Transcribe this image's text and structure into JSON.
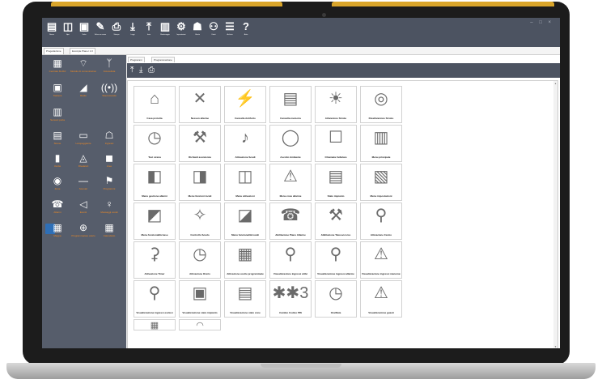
{
  "toolbar": {
    "buttons": [
      {
        "label": "Nuovo",
        "icon": "new-file-icon",
        "glyph": "▤"
      },
      {
        "label": "Apri",
        "icon": "open-icon",
        "glyph": "◫"
      },
      {
        "label": "Salva",
        "icon": "save-icon",
        "glyph": "▣"
      },
      {
        "label": "Salva con nome",
        "icon": "save-as-icon",
        "glyph": "✎"
      },
      {
        "label": "Stampa",
        "icon": "print-icon",
        "glyph": "⎙"
      },
      {
        "label": "Leggi",
        "icon": "download-icon",
        "glyph": "⤓"
      },
      {
        "label": "Invia",
        "icon": "upload-icon",
        "glyph": "⤒"
      },
      {
        "label": "Monitoraggio",
        "icon": "chart-icon",
        "glyph": "▥"
      },
      {
        "label": "Impostazioni",
        "icon": "gear-icon",
        "glyph": "⚙"
      },
      {
        "label": "Utente",
        "icon": "user-icon",
        "glyph": "☗"
      },
      {
        "label": "Utenti",
        "icon": "users-icon",
        "glyph": "⚇"
      },
      {
        "label": "Archivio",
        "icon": "database-icon",
        "glyph": "☰"
      },
      {
        "label": "Aiuto",
        "icon": "help-icon",
        "glyph": "?"
      }
    ],
    "window_controls": "–  □  ×"
  },
  "tabs": [
    "Progettazione",
    "Ecostyle Planer 1.0"
  ],
  "sidebar": {
    "items": [
      {
        "label": "Centrale M-210",
        "glyph": "▦"
      },
      {
        "label": "Modulo di comunicazione",
        "glyph": "⌔"
      },
      {
        "label": "Fotocellula",
        "glyph": "ᛉ"
      },
      {
        "label": "Tastiera",
        "glyph": "▣"
      },
      {
        "label": "Radio",
        "glyph": "◢"
      },
      {
        "label": "Telecomando",
        "glyph": "((•))"
      },
      {
        "label": "Sensori porta",
        "glyph": "▥"
      },
      {
        "label": "Sirene",
        "glyph": "▤"
      },
      {
        "label": "Lampeggiante",
        "glyph": "▭"
      },
      {
        "label": "Ingressi",
        "glyph": "☖"
      },
      {
        "label": "Uscite",
        "glyph": "▮"
      },
      {
        "label": "Rivelatori",
        "glyph": "◬"
      },
      {
        "label": "Aree",
        "glyph": "◼"
      },
      {
        "label": "Zone",
        "glyph": "◉"
      },
      {
        "label": "Scenari",
        "glyph": "—"
      },
      {
        "label": "Programmi",
        "glyph": "⚑"
      },
      {
        "label": "Allarmi",
        "glyph": "☎"
      },
      {
        "label": "Eventi",
        "glyph": "◁"
      },
      {
        "label": "Messaggi vocali",
        "glyph": "♀"
      },
      {
        "label": "Mappa",
        "glyph": "▦"
      },
      {
        "label": "Programmatore orario",
        "glyph": "⊕"
      },
      {
        "label": "Calendario",
        "glyph": "▦"
      }
    ]
  },
  "content": {
    "tabs": [
      "Programmi",
      "Programmazione"
    ],
    "toolbar_icons": [
      {
        "icon": "upload-icon",
        "glyph": "⤒"
      },
      {
        "icon": "download-icon",
        "glyph": "⤓"
      },
      {
        "icon": "print-icon",
        "glyph": "⎙"
      }
    ],
    "tiles": [
      {
        "label": "Casa protetta",
        "glyph": "⌂"
      },
      {
        "label": "Nessun allarme",
        "glyph": "✕"
      },
      {
        "label": "Cancella Antifurto",
        "glyph": "⚡"
      },
      {
        "label": "Cancella memoria",
        "glyph": "▤"
      },
      {
        "label": "Attivazione Strobo",
        "glyph": "☀"
      },
      {
        "label": "Disattivazione Strobo",
        "glyph": "◎"
      },
      {
        "label": "Test sirena",
        "glyph": "◷"
      },
      {
        "label": "Richiedi assistenza",
        "glyph": "⚒"
      },
      {
        "label": "Attivazione Scudi",
        "glyph": "♪"
      },
      {
        "label": "Ascolto Ambiente",
        "glyph": "◯"
      },
      {
        "label": "Chiamata Cellulare",
        "glyph": "☐"
      },
      {
        "label": "Menu principale",
        "glyph": "▥"
      },
      {
        "label": "Menu gestione allarmi",
        "glyph": "◧"
      },
      {
        "label": "Menu funzioni locali",
        "glyph": "◨"
      },
      {
        "label": "Menu attivazioni",
        "glyph": "◫"
      },
      {
        "label": "Menu zone allarme",
        "glyph": "⚠"
      },
      {
        "label": "Stato impianto",
        "glyph": "▤"
      },
      {
        "label": "Menu impostazioni",
        "glyph": "▧"
      },
      {
        "label": "Menu funzionalità base",
        "glyph": "◩"
      },
      {
        "label": "Controllo Scudo",
        "glyph": "✧"
      },
      {
        "label": "Menu funzionalità locali",
        "glyph": "◪"
      },
      {
        "label": "Abilitazione Piano Allarme",
        "glyph": "☎"
      },
      {
        "label": "Abilitazione Telesoccorso",
        "glyph": "⚒"
      },
      {
        "label": "Attivazione Carico",
        "glyph": "⚲"
      },
      {
        "label": "Attivazione Timer",
        "glyph": "⚳"
      },
      {
        "label": "Attivazione Orario",
        "glyph": "◷"
      },
      {
        "label": "Attivazione uscite programmate",
        "glyph": "▦"
      },
      {
        "label": "Visualizzazione ingressi attivi",
        "glyph": "⚲"
      },
      {
        "label": "Visualizzazione ingressi allarme",
        "glyph": "⚲"
      },
      {
        "label": "Visualizzazione ingressi manomessi",
        "glyph": "⚠"
      },
      {
        "label": "Visualizzazione ingressi esclusi",
        "glyph": "⚲"
      },
      {
        "label": "Visualizzazione stato impianto",
        "glyph": "▣"
      },
      {
        "label": "Visualizzazione stato zone",
        "glyph": "▤"
      },
      {
        "label": "Cambio Codice PIN",
        "glyph": "✱✱3"
      },
      {
        "label": "Ora/Data",
        "glyph": "◷"
      },
      {
        "label": "Visualizzazione guasti",
        "glyph": "⚠"
      },
      {
        "label": "",
        "glyph": "▦"
      },
      {
        "label": "",
        "glyph": "◠"
      }
    ]
  }
}
